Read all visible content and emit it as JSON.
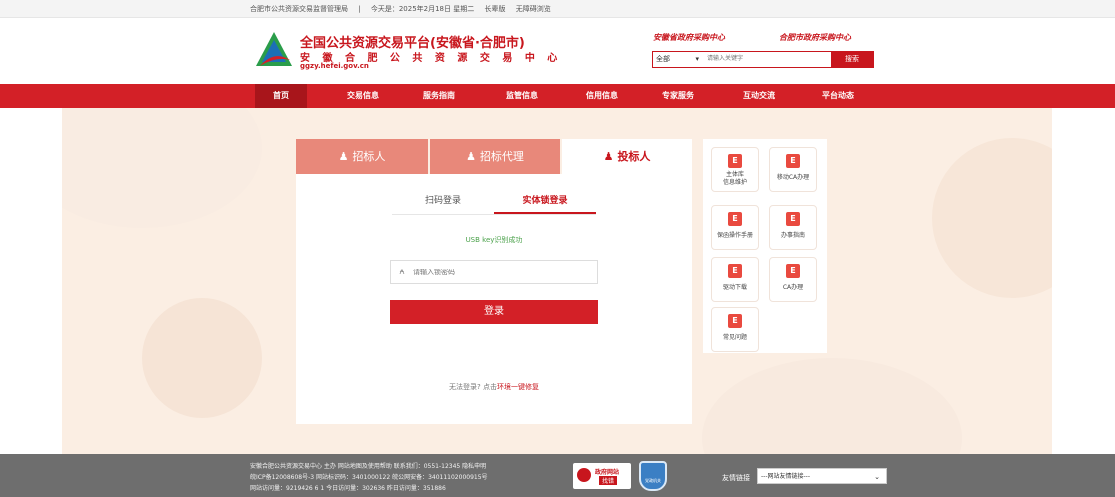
{
  "topbar": {
    "org": "合肥市公共资源交易监督管理局",
    "sep": "|",
    "date": "今天是：2025年2月18日 星期二",
    "elder": "长辈版",
    "access": "无障碍浏览"
  },
  "header": {
    "title": "全国公共资源交易平台(安徽省·合肥市)",
    "subtitle": "安 徽 合 肥 公 共 资 源 交 易 中 心",
    "domain": "ggzy.hefei.gov.cn",
    "link_province": "安徽省政府采购中心",
    "link_city": "合肥市政府采购中心",
    "search": {
      "scope": "全部",
      "placeholder": "请输入关键字",
      "button": "搜索"
    }
  },
  "nav": {
    "items": [
      "首页",
      "交易信息",
      "服务指南",
      "监管信息",
      "信用信息",
      "专家服务",
      "互动交流",
      "平台动态"
    ]
  },
  "login": {
    "tabs": [
      "招标人",
      "招标代理",
      "投标人"
    ],
    "subtabs": [
      "扫码登录",
      "实体锁登录"
    ],
    "status": "USB key识别成功",
    "password_placeholder": "请输入锁密码",
    "submit": "登录",
    "repair_prefix": "无法登录? 点击",
    "repair_link": "环境一键修复"
  },
  "side": {
    "tiles": [
      {
        "label": "主体库\n信息维护",
        "icon": "doc-icon"
      },
      {
        "label": "移动CA办理",
        "icon": "doc-icon"
      },
      {
        "label": "保函操作手册",
        "icon": "doc-icon"
      },
      {
        "label": "办事指南",
        "icon": "doc-icon"
      },
      {
        "label": "驱动下载",
        "icon": "doc-icon"
      },
      {
        "label": "CA办理",
        "icon": "doc-icon"
      },
      {
        "label": "常见问题",
        "icon": "doc-icon"
      }
    ],
    "icon_glyph": "E"
  },
  "footer": {
    "line1": "安徽合肥公共资源交易中心 主办   网站地图及使用帮助   联系我们：0551-12345   隐私申明",
    "line2": "皖ICP备12008608号-3   网站标识码：3401000122   皖公网安备：34011102000915号",
    "line3": "网站访问量：9219426 6 1   今日访问量：302636   昨日访问量：351886",
    "badge_gov_title": "政府网站",
    "badge_gov_sub": "找错",
    "badge_party": "党政机关",
    "friend_label": "友情链接",
    "friend_select": "---网站友情链接---"
  },
  "colors": {
    "brand_red": "#d32027",
    "bg_peach": "#fbeee3",
    "success_green": "#4aa14a",
    "footer_gray": "#6e6e6e"
  }
}
